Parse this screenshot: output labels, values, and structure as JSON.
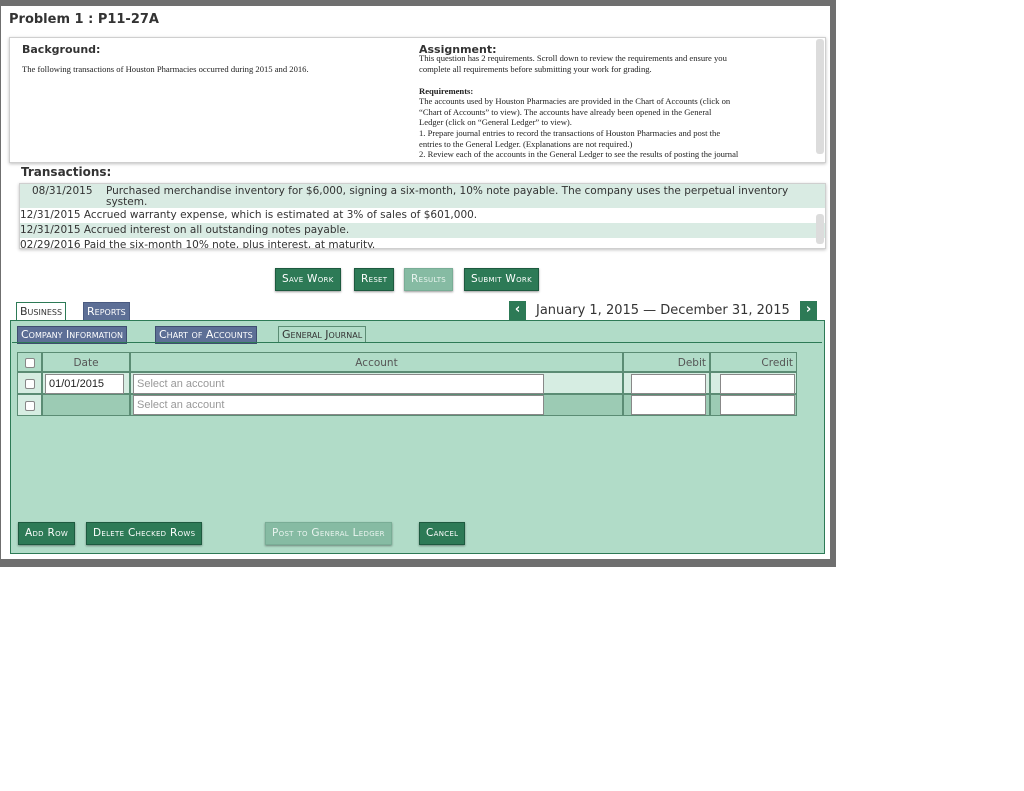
{
  "problem_title": "Problem 1 : P11-27A",
  "background": {
    "heading": "Background:",
    "text": "The following transactions of Houston Pharmacies occurred during 2015 and 2016."
  },
  "assignment": {
    "heading": "Assignment:",
    "intro_line1": "This question has 2 requirements. Scroll down to review the requirements and ensure you",
    "intro_line2": "complete all requirements before submitting your work for grading.",
    "req_heading": "Requirements:",
    "req_line1": "The accounts used by Houston Pharmacies are provided in the Chart of Accounts (click on",
    "req_line2": "“Chart of Accounts” to view).  The accounts have already been opened in the General",
    "req_line3": "Ledger (click on “General Ledger” to view).",
    "req_line4": "1. Prepare journal entries to record the transactions of Houston Pharmacies and post the",
    "req_line5": "entries to the General Ledger. (Explanations are not required.)",
    "req_line6": "2. Review each of the accounts in the General Ledger to see the results of posting the journal"
  },
  "transactions": {
    "heading": "Transactions:",
    "rows": [
      {
        "date": "08/31/2015",
        "text": "Purchased merchandise inventory for $6,000, signing a six-month, 10% note payable. The company uses the perpetual inventory",
        "text2": "system."
      },
      {
        "date": "12/31/2015",
        "text": "Accrued warranty expense, which is estimated at 3% of sales of $601,000."
      },
      {
        "date": "12/31/2015",
        "text": "Accrued interest on all outstanding notes payable."
      },
      {
        "date": "02/29/2016",
        "text": "Paid the six-month 10% note, plus interest, at maturity."
      }
    ]
  },
  "actions": {
    "save": "Save Work",
    "reset": "Reset",
    "results": "Results",
    "submit": "Submit Work"
  },
  "tabs": {
    "business": "Business",
    "reports": "Reports"
  },
  "subtabs": {
    "company_info": "Company Information",
    "chart_of_accounts": "Chart of Accounts",
    "general_journal": "General Journal"
  },
  "period": {
    "range": "January 1, 2015 — December 31, 2015",
    "prev_icon": "chevron-left",
    "next_icon": "chevron-right"
  },
  "journal": {
    "headers": {
      "date": "Date",
      "account": "Account",
      "debit": "Debit",
      "credit": "Credit"
    },
    "rows": [
      {
        "date": "01/01/2015",
        "account_placeholder": "Select an account",
        "debit": "",
        "credit": ""
      },
      {
        "date": "",
        "account_placeholder": "Select an account",
        "debit": "",
        "credit": ""
      }
    ]
  },
  "journal_actions": {
    "add_row": "Add Row",
    "delete_checked": "Delete Checked Rows",
    "post": "Post to General Ledger",
    "cancel": "Cancel"
  },
  "colors": {
    "accent": "#2d7a56",
    "panel_bg": "#b1dcc8",
    "inactive_tab": "#5d6f96"
  }
}
